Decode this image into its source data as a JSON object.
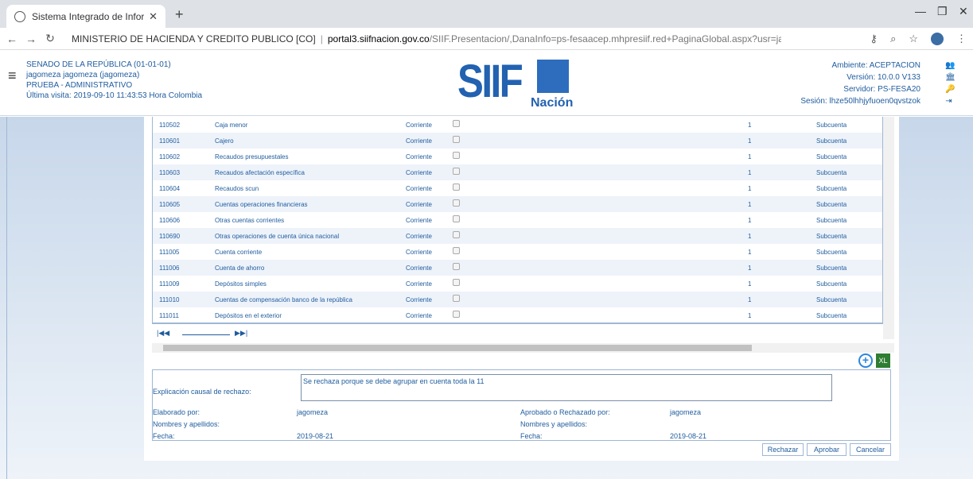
{
  "browser": {
    "tab_title": "Sistema Integrado de Informació",
    "new_tab": "+",
    "url_host": "portal3.siifnacion.gov.co",
    "url_path": "/SIIF.Presentacion/,DanaInfo=ps-fesaacep.mhpresiif.red+PaginaGlobal.aspx?usr=jagomeza&hash=#siif-menu",
    "site_label": "MINISTERIO DE HACIENDA Y CREDITO PUBLICO [CO]"
  },
  "header": {
    "entity": "SENADO DE LA REPÚBLICA (01-01-01)",
    "user": "jagomeza jagomeza (jagomeza)",
    "profile": "PRUEBA - ADMINISTRATIVO",
    "last_visit": "Última visita: 2019-09-10 11:43:53 Hora Colombia",
    "logo_text": "SIIF",
    "logo_sub": "Nación",
    "ambiente": "Ambiente: ACEPTACION",
    "version": "Versión: 10.0.0 V133",
    "servidor": "Servidor: PS-FESA20",
    "sesion": "Sesión: lhze50lhhjyfuoen0qvstzok"
  },
  "table": {
    "rows": [
      {
        "code": "110502",
        "name": "Caja menor",
        "type": "Corriente",
        "level": "1",
        "kind": "Subcuenta"
      },
      {
        "code": "110601",
        "name": "Cajero",
        "type": "Corriente",
        "level": "1",
        "kind": "Subcuenta"
      },
      {
        "code": "110602",
        "name": "Recaudos presupuestales",
        "type": "Corriente",
        "level": "1",
        "kind": "Subcuenta"
      },
      {
        "code": "110603",
        "name": "Recaudos afectación específica",
        "type": "Corriente",
        "level": "1",
        "kind": "Subcuenta"
      },
      {
        "code": "110604",
        "name": "Recaudos scun",
        "type": "Corriente",
        "level": "1",
        "kind": "Subcuenta"
      },
      {
        "code": "110605",
        "name": "Cuentas operaciones financieras",
        "type": "Corriente",
        "level": "1",
        "kind": "Subcuenta"
      },
      {
        "code": "110606",
        "name": "Otras cuentas corrientes",
        "type": "Corriente",
        "level": "1",
        "kind": "Subcuenta"
      },
      {
        "code": "110690",
        "name": "Otras operaciones de cuenta única nacional",
        "type": "Corriente",
        "level": "1",
        "kind": "Subcuenta"
      },
      {
        "code": "111005",
        "name": "Cuenta corriente",
        "type": "Corriente",
        "level": "1",
        "kind": "Subcuenta"
      },
      {
        "code": "111006",
        "name": "Cuenta de ahorro",
        "type": "Corriente",
        "level": "1",
        "kind": "Subcuenta"
      },
      {
        "code": "111009",
        "name": "Depósitos simples",
        "type": "Corriente",
        "level": "1",
        "kind": "Subcuenta"
      },
      {
        "code": "111010",
        "name": "Cuentas de compensación banco de la república",
        "type": "Corriente",
        "level": "1",
        "kind": "Subcuenta"
      },
      {
        "code": "111011",
        "name": "Depósitos en el exterior",
        "type": "Corriente",
        "level": "1",
        "kind": "Subcuenta"
      }
    ],
    "pager_first": "|◀◀",
    "pager_last": "▶▶|"
  },
  "form": {
    "reason_label": "Explicación causal de rechazo:",
    "reason_value": "Se rechaza porque se debe agrupar en cuenta toda la 11",
    "elaborado_label": "Elaborado por:",
    "elaborado_value": "jagomeza",
    "aprobado_label": "Aprobado o Rechazado por:",
    "aprobado_value": "jagomeza",
    "nombres_label": "Nombres y apellidos:",
    "nombres_label2": "Nombres y apellidos:",
    "fecha_label": "Fecha:",
    "fecha_value": "2019-08-21",
    "fecha_label2": "Fecha:",
    "fecha_value2": "2019-08-21"
  },
  "buttons": {
    "rechazar": "Rechazar",
    "aprobar": "Aprobar",
    "cancelar": "Cancelar"
  }
}
